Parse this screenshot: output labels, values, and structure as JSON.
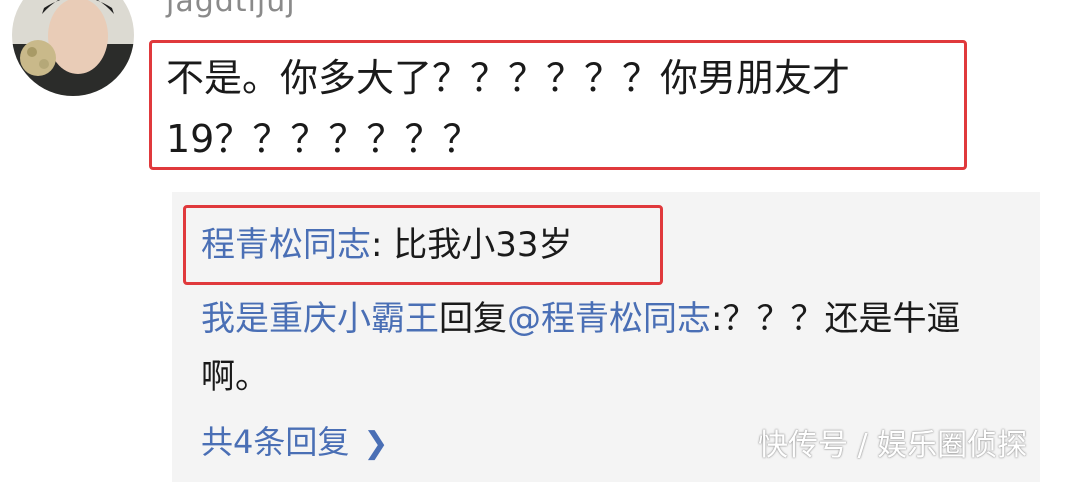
{
  "comment": {
    "username": "jagdtljuj",
    "text": "不是。你多大了？？？？？？你男朋友才19？？？？？？？"
  },
  "replies": [
    {
      "author": "程青松同志",
      "separator": ": ",
      "text": "比我小33岁"
    },
    {
      "author": "我是重庆小霸王",
      "reply_word": "回复",
      "target": "@程青松同志",
      "separator": ":",
      "text": "？？？还是牛逼啊。"
    }
  ],
  "more_replies": {
    "label": "共4条回复",
    "icon": "chevron-right-icon"
  },
  "watermark": "快传号 / 娱乐圈侦探"
}
